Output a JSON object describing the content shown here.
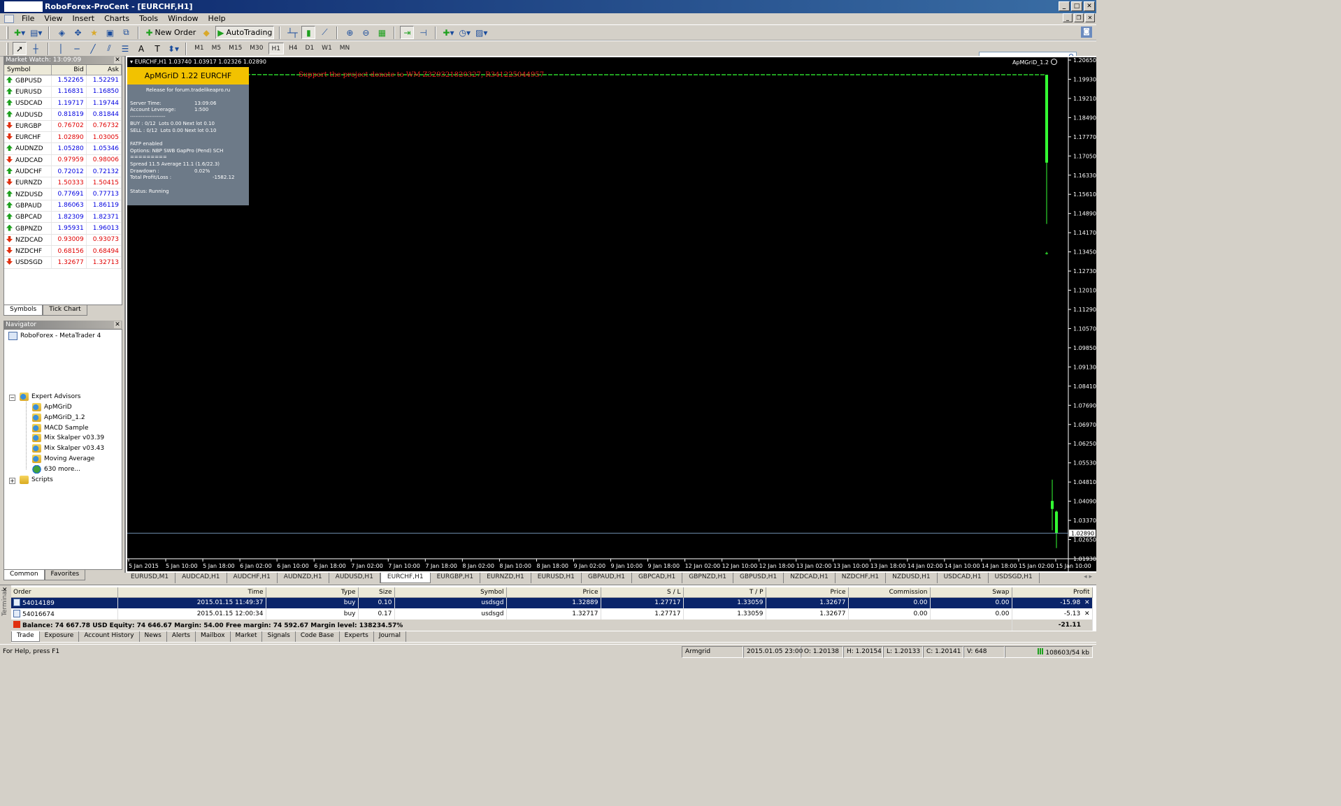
{
  "window": {
    "title": "RoboForex-ProCent - [EURCHF,H1]"
  },
  "menu": [
    "File",
    "View",
    "Insert",
    "Charts",
    "Tools",
    "Window",
    "Help"
  ],
  "toolbar": {
    "new_order": "New Order",
    "autotrading": "AutoTrading"
  },
  "timeframes": [
    "M1",
    "M5",
    "M15",
    "M30",
    "H1",
    "H4",
    "D1",
    "W1",
    "MN"
  ],
  "active_timeframe": "H1",
  "market_watch": {
    "title": "Market Watch: 13:09:09",
    "headers": {
      "symbol": "Symbol",
      "bid": "Bid",
      "ask": "Ask"
    },
    "rows": [
      {
        "symbol": "GBPUSD",
        "bid": "1.52265",
        "ask": "1.52291",
        "dir": "up",
        "color": "blue"
      },
      {
        "symbol": "EURUSD",
        "bid": "1.16831",
        "ask": "1.16850",
        "dir": "up",
        "color": "blue"
      },
      {
        "symbol": "USDCAD",
        "bid": "1.19717",
        "ask": "1.19744",
        "dir": "up",
        "color": "blue"
      },
      {
        "symbol": "AUDUSD",
        "bid": "0.81819",
        "ask": "0.81844",
        "dir": "up",
        "color": "blue"
      },
      {
        "symbol": "EURGBP",
        "bid": "0.76702",
        "ask": "0.76732",
        "dir": "down",
        "color": "red"
      },
      {
        "symbol": "EURCHF",
        "bid": "1.02890",
        "ask": "1.03005",
        "dir": "down",
        "color": "red"
      },
      {
        "symbol": "AUDNZD",
        "bid": "1.05280",
        "ask": "1.05346",
        "dir": "up",
        "color": "blue"
      },
      {
        "symbol": "AUDCAD",
        "bid": "0.97959",
        "ask": "0.98006",
        "dir": "down",
        "color": "red"
      },
      {
        "symbol": "AUDCHF",
        "bid": "0.72012",
        "ask": "0.72132",
        "dir": "up",
        "color": "blue"
      },
      {
        "symbol": "EURNZD",
        "bid": "1.50333",
        "ask": "1.50415",
        "dir": "down",
        "color": "red"
      },
      {
        "symbol": "NZDUSD",
        "bid": "0.77691",
        "ask": "0.77713",
        "dir": "up",
        "color": "blue"
      },
      {
        "symbol": "GBPAUD",
        "bid": "1.86063",
        "ask": "1.86119",
        "dir": "up",
        "color": "blue"
      },
      {
        "symbol": "GBPCAD",
        "bid": "1.82309",
        "ask": "1.82371",
        "dir": "up",
        "color": "blue"
      },
      {
        "symbol": "GBPNZD",
        "bid": "1.95931",
        "ask": "1.96013",
        "dir": "up",
        "color": "blue"
      },
      {
        "symbol": "NZDCAD",
        "bid": "0.93009",
        "ask": "0.93073",
        "dir": "down",
        "color": "red"
      },
      {
        "symbol": "NZDCHF",
        "bid": "0.68156",
        "ask": "0.68494",
        "dir": "down",
        "color": "red"
      },
      {
        "symbol": "USDSGD",
        "bid": "1.32677",
        "ask": "1.32713",
        "dir": "down",
        "color": "red"
      }
    ],
    "tabs": [
      "Symbols",
      "Tick Chart"
    ]
  },
  "navigator": {
    "title": "Navigator",
    "root": "RoboForex - MetaTrader 4",
    "expert_advisors": "Expert Advisors",
    "experts": [
      "ApMGriD",
      "ApMGriD_1.2",
      "MACD Sample",
      "Mix Skalper v03.39",
      "Mix Skalper v03.43",
      "Moving Average",
      "630 more..."
    ],
    "scripts": "Scripts",
    "tabs": [
      "Common",
      "Favorites"
    ]
  },
  "chart": {
    "header": "EURCHF,H1  1.03740 1.03917 1.02326 1.02890",
    "ea_name": "ApMGriD_1.2",
    "donate": "Support the project donate to WM Z329321820327, R341225044957",
    "current_price": "1.02890",
    "price_labels": [
      "1.20650",
      "1.19930",
      "1.19210",
      "1.18490",
      "1.17770",
      "1.17050",
      "1.16330",
      "1.15610",
      "1.14890",
      "1.14170",
      "1.13450",
      "1.12730",
      "1.12010",
      "1.11290",
      "1.10570",
      "1.09850",
      "1.09130",
      "1.08410",
      "1.07690",
      "1.06970",
      "1.06250",
      "1.05530",
      "1.04810",
      "1.04090",
      "1.03370",
      "1.02650",
      "1.01930"
    ],
    "time_labels": [
      "5 Jan 2015",
      "5 Jan 10:00",
      "5 Jan 18:00",
      "6 Jan 02:00",
      "6 Jan 10:00",
      "6 Jan 18:00",
      "7 Jan 02:00",
      "7 Jan 10:00",
      "7 Jan 18:00",
      "8 Jan 02:00",
      "8 Jan 10:00",
      "8 Jan 18:00",
      "9 Jan 02:00",
      "9 Jan 10:00",
      "9 Jan 18:00",
      "12 Jan 02:00",
      "12 Jan 10:00",
      "12 Jan 18:00",
      "13 Jan 02:00",
      "13 Jan 10:00",
      "13 Jan 18:00",
      "14 Jan 02:00",
      "14 Jan 10:00",
      "14 Jan 18:00",
      "15 Jan 02:00",
      "15 Jan 10:00"
    ],
    "colors": {
      "background": "#000000",
      "bull": "#33ff33",
      "axis": "#ffffff",
      "price_line": "#6f8faf"
    }
  },
  "chart_data": {
    "type": "line",
    "x": [
      "5 Jan 2015",
      "5 Jan 10:00",
      "5 Jan 18:00",
      "6 Jan 02:00",
      "6 Jan 10:00",
      "6 Jan 18:00",
      "7 Jan 02:00",
      "7 Jan 10:00",
      "7 Jan 18:00",
      "8 Jan 02:00",
      "8 Jan 10:00",
      "8 Jan 18:00",
      "9 Jan 02:00",
      "9 Jan 10:00",
      "9 Jan 18:00",
      "12 Jan 02:00",
      "12 Jan 10:00",
      "12 Jan 18:00",
      "13 Jan 02:00",
      "13 Jan 10:00",
      "13 Jan 18:00",
      "14 Jan 02:00",
      "14 Jan 10:00",
      "14 Jan 18:00",
      "15 Jan 02:00",
      "15 Jan 10:00"
    ],
    "series": [
      {
        "values": [
          1.2011,
          1.201,
          1.201,
          1.2011,
          1.201,
          1.201,
          1.201,
          1.201,
          1.201,
          1.201,
          1.201,
          1.201,
          1.201,
          1.201,
          1.201,
          1.201,
          1.201,
          1.201,
          1.201,
          1.201,
          1.201,
          1.201,
          1.201,
          1.201,
          1.201,
          1.201
        ]
      }
    ],
    "candles_15_jan": [
      {
        "open": 1.201,
        "high": 1.201,
        "low": 1.145,
        "close": 1.168
      },
      {
        "open": 1.134,
        "high": 1.1345,
        "low": 1.1335,
        "close": 1.134
      },
      {
        "open": 1.041,
        "high": 1.049,
        "low": 1.03,
        "close": 1.038
      },
      {
        "open": 1.037,
        "high": 1.0374,
        "low": 1.0233,
        "close": 1.0289
      }
    ],
    "ylim": [
      1.0193,
      1.2065
    ],
    "grid": false
  },
  "ea_panel": {
    "title": "ApMGriD 1.22 EURCHF",
    "release": "Release for forum.tradelikeapro.ru",
    "server_time_label": "Server Time:",
    "server_time": "13:09:06",
    "leverage_label": "Account Leverage:",
    "leverage": "1:500",
    "divider1": "--------------------",
    "buy": "BUY : 0/12  Lots 0.00 Next lot 0.10",
    "sell": "SELL : 0/12  Lots 0.00 Next lot 0.10",
    "fatp": "FATP enabled",
    "options": "Options: NBP SWB GapPro (Pend) SCH",
    "divider2": "=========",
    "spread": "Spread 11.5 Average 11.1 (1.6/22.3)",
    "drawdown_label": "Drawdown :",
    "drawdown": "0.02%",
    "pl_label": "Total Profit/Loss :",
    "pl": "-1582.12",
    "status": "Status: Running"
  },
  "chart_tabs": [
    "EURUSD,M1",
    "AUDCAD,H1",
    "AUDCHF,H1",
    "AUDNZD,H1",
    "AUDUSD,H1",
    "EURCHF,H1",
    "EURGBP,H1",
    "EURNZD,H1",
    "EURUSD,H1",
    "GBPAUD,H1",
    "GBPCAD,H1",
    "GBPNZD,H1",
    "GBPUSD,H1",
    "NZDCAD,H1",
    "NZDCHF,H1",
    "NZDUSD,H1",
    "USDCAD,H1",
    "USDSGD,H1"
  ],
  "active_chart_tab": "EURCHF,H1",
  "terminal": {
    "side_label": "Terminal",
    "headers": [
      "Order",
      "Time",
      "Type",
      "Size",
      "Symbol",
      "Price",
      "S / L",
      "T / P",
      "Price",
      "Commission",
      "Swap",
      "Profit"
    ],
    "orders": [
      {
        "order": "54014189",
        "time": "2015.01.15 11:49:37",
        "type": "buy",
        "size": "0.10",
        "symbol": "usdsgd",
        "price": "1.32889",
        "sl": "1.27717",
        "tp": "1.33059",
        "cur": "1.32677",
        "commission": "0.00",
        "swap": "0.00",
        "profit": "-15.98"
      },
      {
        "order": "54016674",
        "time": "2015.01.15 12:00:34",
        "type": "buy",
        "size": "0.17",
        "symbol": "usdsgd",
        "price": "1.32717",
        "sl": "1.27717",
        "tp": "1.33059",
        "cur": "1.32677",
        "commission": "0.00",
        "swap": "0.00",
        "profit": "-5.13"
      }
    ],
    "balance_line": "Balance: 74 667.78 USD  Equity: 74 646.67  Margin: 54.00  Free margin: 74 592.67  Margin level: 138234.57%",
    "total_profit": "-21.11",
    "tabs": [
      "Trade",
      "Exposure",
      "Account History",
      "News",
      "Alerts",
      "Mailbox",
      "Market",
      "Signals",
      "Code Base",
      "Experts",
      "Journal"
    ]
  },
  "statusbar": {
    "help": "For Help, press F1",
    "profile": "Armgrid",
    "datetime": "2015.01.05 23:00",
    "open": "O: 1.20138",
    "high": "H: 1.20154",
    "low": "L: 1.20133",
    "close": "C: 1.20141",
    "volume": "V: 648",
    "traffic": "108603/54 kb"
  }
}
